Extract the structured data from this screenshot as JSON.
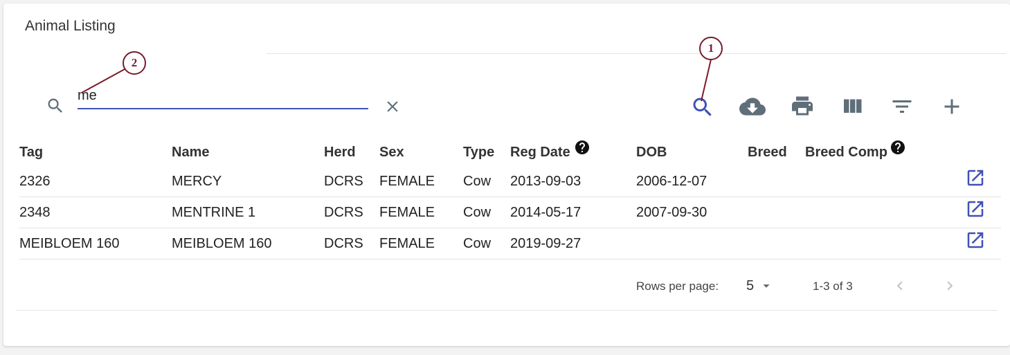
{
  "page": {
    "title": "Animal Listing"
  },
  "search": {
    "value": "me"
  },
  "toolbar": {
    "search_icon": "search-icon",
    "download_icon": "cloud-download-icon",
    "print_icon": "print-icon",
    "columns_icon": "view-column-icon",
    "filter_icon": "filter-list-icon",
    "add_icon": "add-icon",
    "accent_color": "#3f51b5",
    "icon_color": "#5f6f7a"
  },
  "table": {
    "headers": {
      "tag": "Tag",
      "name": "Name",
      "herd": "Herd",
      "sex": "Sex",
      "type": "Type",
      "reg_date": "Reg Date",
      "dob": "DOB",
      "breed": "Breed",
      "breed_comp": "Breed Comp"
    },
    "rows": [
      {
        "tag": "2326",
        "name": "MERCY",
        "herd": "DCRS",
        "sex": "FEMALE",
        "type": "Cow",
        "reg_date": "2013-09-03",
        "dob": "2006-12-07",
        "breed": "",
        "breed_comp": ""
      },
      {
        "tag": "2348",
        "name": "MENTRINE 1",
        "herd": "DCRS",
        "sex": "FEMALE",
        "type": "Cow",
        "reg_date": "2014-05-17",
        "dob": "2007-09-30",
        "breed": "",
        "breed_comp": ""
      },
      {
        "tag": "MEIBLOEM 160",
        "name": "MEIBLOEM 160",
        "herd": "DCRS",
        "sex": "FEMALE",
        "type": "Cow",
        "reg_date": "2019-09-27",
        "dob": "",
        "breed": "",
        "breed_comp": ""
      }
    ]
  },
  "pagination": {
    "rows_per_page_label": "Rows per page:",
    "rows_per_page_value": "5",
    "range": "1-3 of 3"
  },
  "annotations": {
    "callout_1": "1",
    "callout_2": "2",
    "color": "#7b1a2a"
  }
}
